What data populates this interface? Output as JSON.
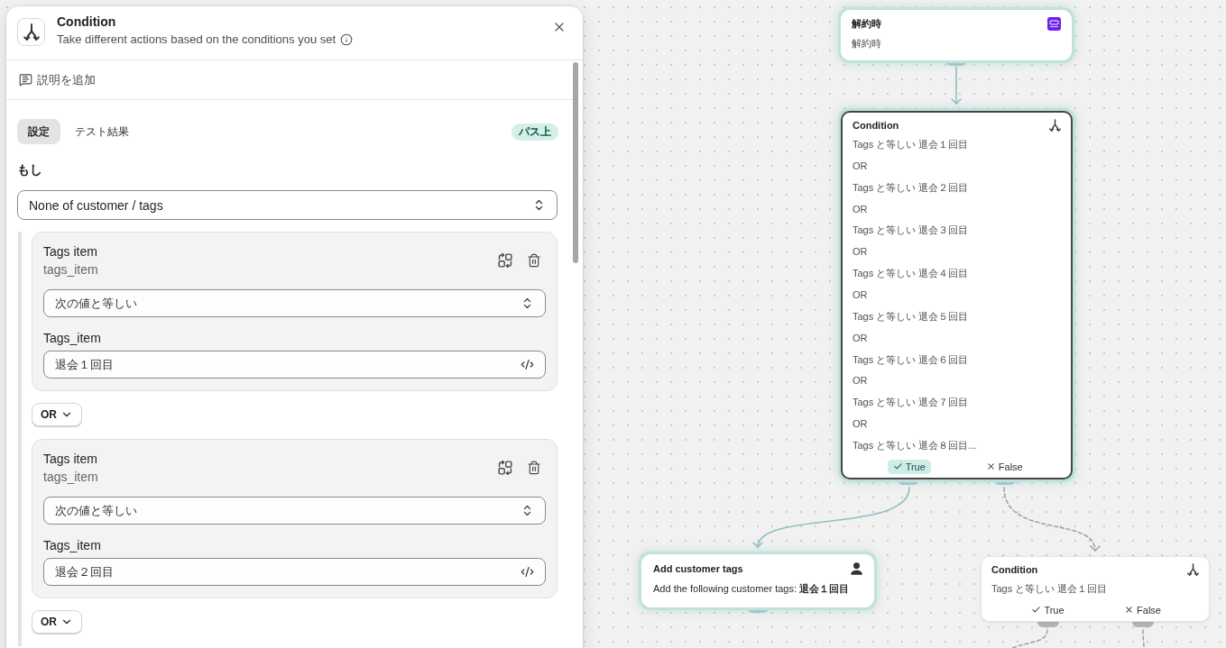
{
  "panel": {
    "title": "Condition",
    "subtitle": "Take different actions based on the conditions you set",
    "add_description": "説明を追加",
    "tabs": [
      {
        "label": "設定",
        "selected": true
      },
      {
        "label": "テスト結果",
        "selected": false
      }
    ],
    "badge": "パス上",
    "if_label": "もし",
    "scope": "None of customer / tags",
    "conditions": [
      {
        "title": "Tags item",
        "key": "tags_item",
        "operator": "次の値と等しい",
        "value_label": "Tags_item",
        "value": "退会１回目",
        "joiner": "OR"
      },
      {
        "title": "Tags item",
        "key": "tags_item",
        "operator": "次の値と等しい",
        "value_label": "Tags_item",
        "value": "退会２回目",
        "joiner": "OR"
      }
    ]
  },
  "canvas": {
    "nodes": [
      {
        "kind": "trigger",
        "title": "解約時",
        "text": "解約時",
        "on_path": true,
        "selected": false
      },
      {
        "kind": "condition",
        "title": "Condition",
        "lines": [
          "Tags と等しい 退会１回目",
          "OR",
          "Tags と等しい 退会２回目",
          "OR",
          "Tags と等しい 退会３回目",
          "OR",
          "Tags と等しい 退会４回目",
          "OR",
          "Tags と等しい 退会５回目",
          "OR",
          "Tags と等しい 退会６回目",
          "OR",
          "Tags と等しい 退会７回目",
          "OR",
          "Tags と等しい 退会８回目..."
        ],
        "branches": [
          {
            "label": "True",
            "on_path": true
          },
          {
            "label": "False",
            "on_path": false
          }
        ],
        "on_path": true,
        "selected": true
      },
      {
        "kind": "action",
        "title": "Add customer tags",
        "text": "Add the following customer tags: **退会１回目**",
        "on_path": true,
        "selected": false
      },
      {
        "kind": "condition",
        "title": "Condition",
        "lines": [
          "Tags と等しい 退会１回目"
        ],
        "branches": [
          {
            "label": "True",
            "on_path": false
          },
          {
            "label": "False",
            "on_path": false
          }
        ],
        "on_path": false,
        "selected": false
      }
    ]
  }
}
